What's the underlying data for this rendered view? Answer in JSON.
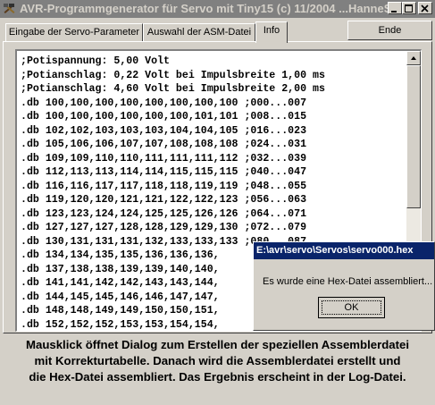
{
  "window": {
    "title": "AVR-Programmgenerator für Servo mit Tiny15  (c) 11/2004 ...HanneS...",
    "icon": "hammer-tools-icon",
    "controls": [
      "minimize-icon",
      "maximize-icon",
      "close-icon"
    ]
  },
  "tabs": [
    {
      "label": "Eingabe der Servo-Parameter",
      "active": false
    },
    {
      "label": "Auswahl der ASM-Datei",
      "active": false
    },
    {
      "label": "Info",
      "active": true
    }
  ],
  "end_button": "Ende",
  "memo": {
    "lines": [
      ";Potispannung: 5,00 Volt",
      ";Potianschlag: 0,22 Volt bei Impulsbreite 1,00 ms",
      ";Potianschlag: 4,60 Volt bei Impulsbreite 2,00 ms",
      ".db 100,100,100,100,100,100,100,100 ;000...007",
      ".db 100,100,100,100,100,100,101,101 ;008...015",
      ".db 102,102,103,103,103,104,104,105 ;016...023",
      ".db 105,106,106,107,107,108,108,108 ;024...031",
      ".db 109,109,110,110,111,111,111,112 ;032...039",
      ".db 112,113,113,114,114,115,115,115 ;040...047",
      ".db 116,116,117,117,118,118,119,119 ;048...055",
      ".db 119,120,120,121,121,122,122,123 ;056...063",
      ".db 123,123,124,124,125,125,126,126 ;064...071",
      ".db 127,127,127,128,128,129,129,130 ;072...079",
      ".db 130,131,131,131,132,133,133,133 ;080...087",
      ".db 134,134,135,135,136,136,136,",
      ".db 137,138,138,139,139,140,140,",
      ".db 141,141,142,142,143,143,144,",
      ".db 144,145,145,146,146,147,147,",
      ".db 148,148,149,149,150,150,151,",
      ".db 152,152,152,153,153,154,154,"
    ]
  },
  "info_text": [
    "Mausklick öffnet Dialog zum Erstellen der speziellen Assemblerdatei",
    "mit Korrekturtabelle. Danach wird die Assemblerdatei erstellt und",
    "die Hex-Datei assembliert. Das Ergebnis erscheint in der Log-Datei."
  ],
  "dialog": {
    "title": "E:\\avr\\servo\\Servos\\servo000.hex",
    "message": "Es wurde eine Hex-Datei assembliert...",
    "ok_label": "OK"
  }
}
